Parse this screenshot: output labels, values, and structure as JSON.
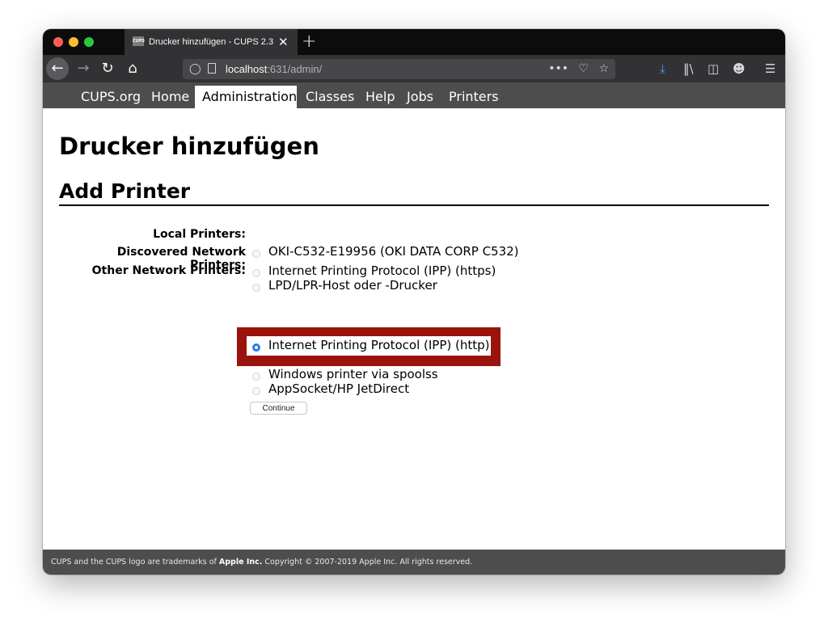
{
  "browser": {
    "tab_title": "Drucker hinzufügen - CUPS 2.3",
    "tab_favicon": "CUPS",
    "tab_close": "✕",
    "newtab": "+",
    "url_host": "localhost",
    "url_rest": ":631/admin/"
  },
  "cups_nav": {
    "items": [
      "CUPS.org",
      "Home",
      "Administration",
      "Classes",
      "Help",
      "Jobs",
      "Printers"
    ],
    "active": "Administration"
  },
  "page": {
    "title": "Drucker hinzufügen",
    "subtitle": "Add Printer"
  },
  "form": {
    "local_label": "Local Printers:",
    "discovered_label": "Discovered Network Printers:",
    "other_label": "Other Network Printers:",
    "discovered_options": [
      "OKI-C532-E19956 (OKI DATA CORP C532)"
    ],
    "other_options": [
      "Internet Printing Protocol (IPP) (https)",
      "LPD/LPR-Host oder -Drucker",
      "Internet Printing Protocol (IPP) (http)",
      "Windows printer via spoolss",
      "AppSocket/HP JetDirect"
    ],
    "selected": "Internet Printing Protocol (IPP) (http)",
    "continue_label": "Continue"
  },
  "footer": {
    "prefix": "CUPS and the CUPS logo are trademarks of ",
    "company": "Apple Inc.",
    "suffix": " Copyright © 2007-2019 Apple Inc. All rights reserved."
  },
  "colors": {
    "highlight": "#9a140e",
    "radio_selected": "#1d7ff0",
    "nav_bg": "#4d4d4d"
  }
}
